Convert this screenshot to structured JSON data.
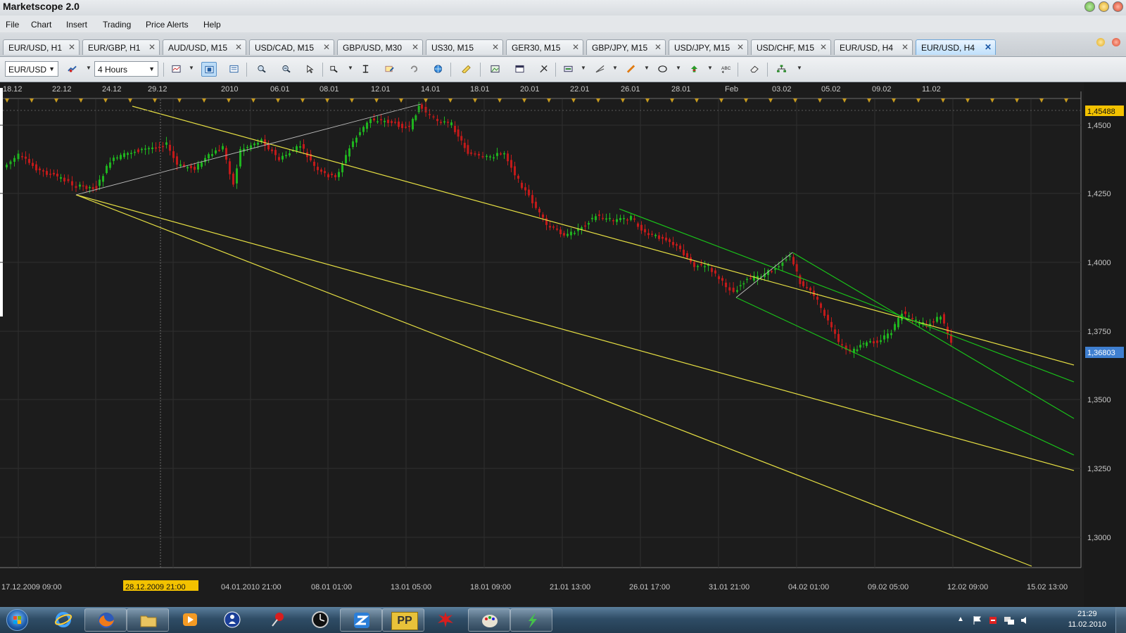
{
  "app": {
    "title": "Marketscope 2.0"
  },
  "menu": [
    "File",
    "Chart",
    "Insert",
    "Trading",
    "Price Alerts",
    "Help"
  ],
  "tabs": [
    {
      "label": "EUR/USD, H1",
      "active": false
    },
    {
      "label": "EUR/GBP, H1",
      "active": false
    },
    {
      "label": "AUD/USD, M15",
      "active": false
    },
    {
      "label": "USD/CAD, M15",
      "active": false
    },
    {
      "label": "GBP/USD, M30",
      "active": false
    },
    {
      "label": "US30, M15",
      "active": false
    },
    {
      "label": "GER30, M15",
      "active": false
    },
    {
      "label": "GBP/JPY, M15",
      "active": false
    },
    {
      "label": "USD/JPY, M15",
      "active": false
    },
    {
      "label": "USD/CHF, M15",
      "active": false
    },
    {
      "label": "EUR/USD, H4",
      "active": false
    },
    {
      "label": "EUR/USD, H4",
      "active": true
    }
  ],
  "tab_close_glyph": "✕",
  "toolbar": {
    "instrument": "EUR/USD",
    "timeframe": "4 Hours",
    "icons": [
      "chart-type-icon",
      "template-icon",
      "layout-icon",
      "zoom-in-icon",
      "zoom-out-icon",
      "cursor-icon",
      "zoom-box-icon",
      "crosshair-icon",
      "data-window-icon",
      "refresh-icon",
      "globe-icon",
      "ruler-icon",
      "image-icon",
      "calendar-icon",
      "tools-icon",
      "insert-indicator-icon",
      "trendline-icon",
      "pencil-icon",
      "ellipse-icon",
      "signal-icon",
      "text-label-icon",
      "eraser-icon",
      "network-icon",
      "more-icon"
    ]
  },
  "chart": {
    "symbol": "EUR/USD",
    "timeframe": "H4",
    "top_date_labels": [
      "18.12",
      "22.12",
      "24.12",
      "29.12",
      "2010",
      "06.01",
      "08.01",
      "12.01",
      "14.01",
      "18.01",
      "20.01",
      "22.01",
      "26.01",
      "28.01",
      "Feb",
      "03.02",
      "05.02",
      "09.02",
      "11.02"
    ],
    "bottom_date_labels": [
      "17.12.2009 09:00",
      "28.12.2009 21:00",
      "04.01.2010 21:00",
      "08.01 01:00",
      "13.01 05:00",
      "18.01 09:00",
      "21.01 13:00",
      "26.01 17:00",
      "31.01 21:00",
      "04.02 01:00",
      "09.02 05:00",
      "12.02 09:00",
      "15.02 13:00"
    ],
    "highlight_date": "28.12.2009 21:00",
    "price_labels": [
      "1,4500",
      "1,4250",
      "1,4000",
      "1,3750",
      "1,3500",
      "1,3250",
      "1,3000"
    ],
    "high_marker": "1,45488",
    "current_price": "1,36803",
    "colors": {
      "background": "#1c1c1c",
      "up_candle": "#1fb41f",
      "down_candle": "#c21a1a",
      "channel_yellow": "#e7e043",
      "channel_green": "#19c119",
      "highlight": "#f3c200",
      "current_price_bg": "#3f7fd0"
    }
  },
  "taskbar": {
    "apps": [
      "start-orb",
      "internet-explorer-icon",
      "firefox-icon",
      "folder-icon",
      "media-player-icon",
      "user-icon",
      "pushpin-icon",
      "clock-app-icon",
      "marketscope-icon",
      "pp-icon",
      "splash-icon",
      "paint-icon",
      "arrow-app-icon"
    ],
    "pp_label": "PP",
    "time": "21:29",
    "date": "11.02.2010"
  }
}
